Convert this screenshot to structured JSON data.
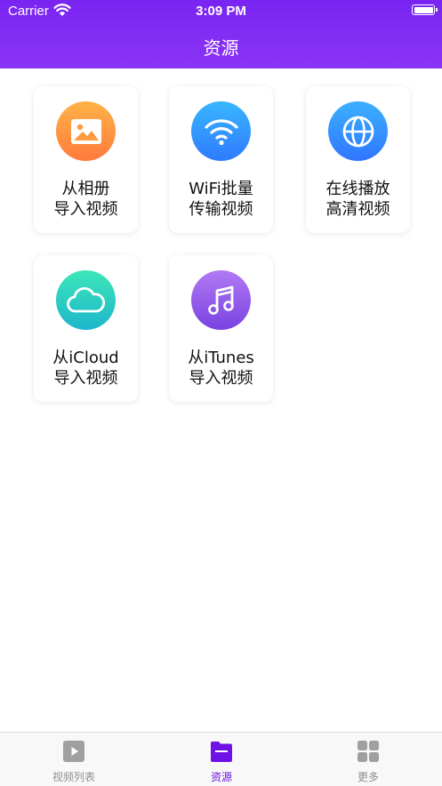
{
  "status_bar": {
    "carrier": "Carrier",
    "time": "3:09 PM"
  },
  "header": {
    "title": "资源"
  },
  "cards": [
    {
      "line1": "从相册",
      "line2": "导入视频",
      "icon": "photo-icon",
      "gradient": [
        "#ffb347",
        "#ff7a3c"
      ]
    },
    {
      "line1": "WiFi批量",
      "line2": "传输视频",
      "icon": "wifi-icon",
      "gradient": [
        "#38b6ff",
        "#2f7bff"
      ]
    },
    {
      "line1": "在线播放",
      "line2": "高清视频",
      "icon": "globe-icon",
      "gradient": [
        "#3cb0ff",
        "#2f76ff"
      ]
    },
    {
      "line1": "从iCloud",
      "line2": "导入视频",
      "icon": "cloud-icon",
      "gradient": [
        "#3ee6b8",
        "#1cb6cc"
      ]
    },
    {
      "line1": "从iTunes",
      "line2": "导入视频",
      "icon": "music-icon",
      "gradient": [
        "#b17af5",
        "#7a42e0"
      ]
    }
  ],
  "tabbar": {
    "items": [
      {
        "label": "视频列表",
        "icon": "play-icon",
        "active": false
      },
      {
        "label": "资源",
        "icon": "folder-icon",
        "active": true
      },
      {
        "label": "更多",
        "icon": "grid-icon",
        "active": false
      }
    ],
    "active_color": "#6f12e6",
    "inactive_color": "#8e8e8e"
  }
}
